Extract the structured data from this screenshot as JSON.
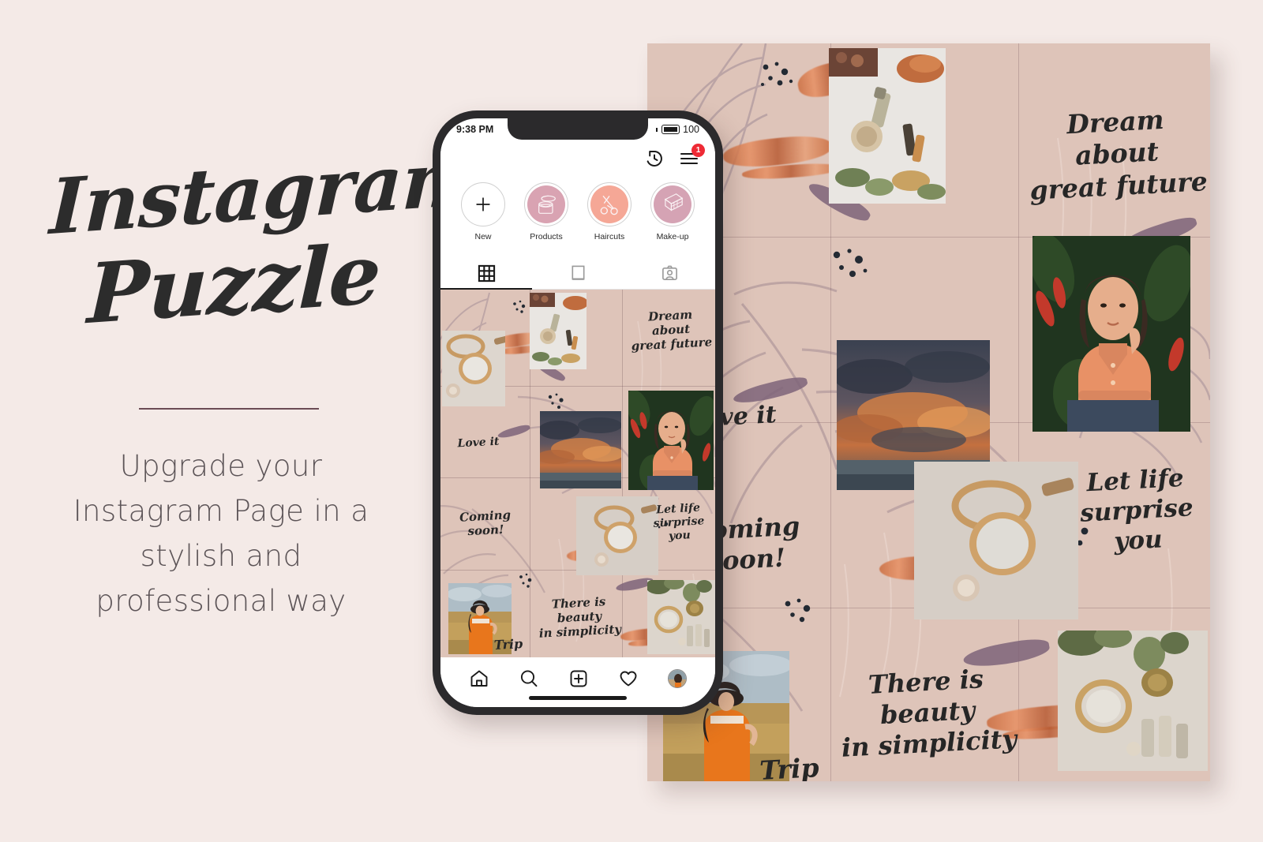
{
  "theme": {
    "page_bg": "#F4EAE7",
    "board_bg": "#DEC4B9",
    "ink": "#262626",
    "divider": "#6B4B55",
    "badge_red": "#EE2A35",
    "phone_frame": "#2B2A2C"
  },
  "left": {
    "title_line_1": "Instagram",
    "title_line_2": "Puzzle",
    "subtitle": "Upgrade your Instagram Page in a stylish and professional way"
  },
  "phone": {
    "status": {
      "time": "9:38 PM",
      "battery_level": "100",
      "battery_icon": "battery-icon"
    },
    "header": {
      "history_icon": "history-clock-icon",
      "menu_icon": "hamburger-menu-icon",
      "menu_badge": "1"
    },
    "highlights": [
      {
        "label": "New",
        "icon": "plus-icon",
        "fill": "#FFFFFF"
      },
      {
        "label": "Products",
        "icon": "cosmetic-jar-icon",
        "fill": "#D9A3B2"
      },
      {
        "label": "Haircuts",
        "icon": "scissors-icon",
        "fill": "#F5A796"
      },
      {
        "label": "Make-up",
        "icon": "makeup-palette-icon",
        "fill": "#D5A3B4"
      }
    ],
    "tabs": [
      {
        "name": "grid-tab",
        "icon": "grid-icon",
        "active": true
      },
      {
        "name": "reels-tab",
        "icon": "portrait-icon",
        "active": false
      },
      {
        "name": "tagged-tab",
        "icon": "tagged-person-icon",
        "active": false
      }
    ],
    "bottom_nav": [
      {
        "name": "home",
        "icon": "home-icon"
      },
      {
        "name": "search",
        "icon": "search-icon"
      },
      {
        "name": "create",
        "icon": "plus-square-icon"
      },
      {
        "name": "likes",
        "icon": "heart-icon"
      },
      {
        "name": "profile",
        "icon": "avatar-icon"
      }
    ],
    "feed_quotes": [
      "Dream about\ngreat future",
      "Love it",
      "Coming soon!",
      "Let life\nsurprise you",
      "There is beauty\nin simplicity",
      "Trip"
    ]
  },
  "board": {
    "quotes": [
      "Dream about\ngreat future",
      "Love it",
      "Coming soon!",
      "Let life\nsurprise you",
      "There is beauty\nin simplicity",
      "Trip"
    ]
  }
}
